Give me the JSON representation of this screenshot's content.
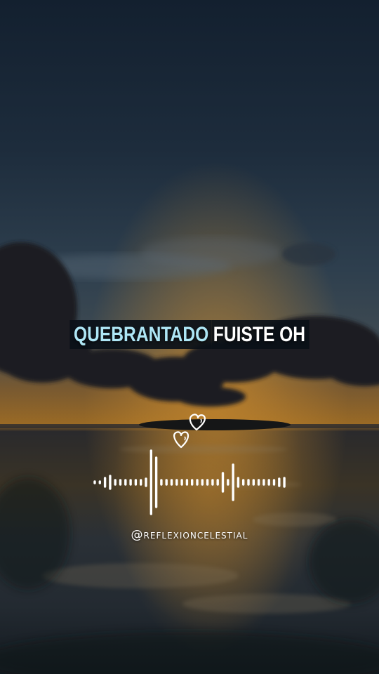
{
  "caption": {
    "highlight_word": "QUEBRANTADO",
    "rest": "FUISTE OH"
  },
  "handle": "@reflexioncelestial",
  "colors": {
    "highlight": "#aee6f5",
    "text": "#ffffff"
  },
  "icons": [
    "heart-icon",
    "heart-icon"
  ]
}
